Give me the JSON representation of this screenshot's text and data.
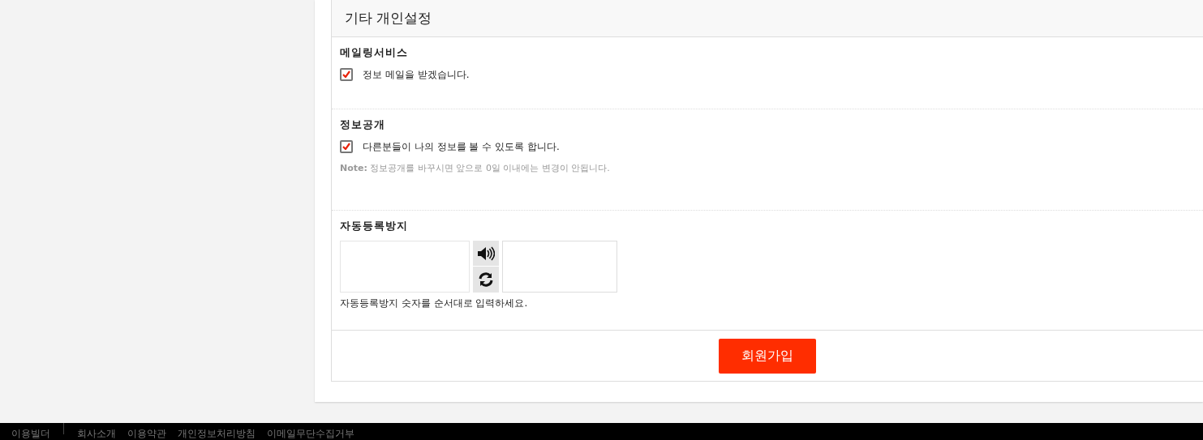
{
  "section_title": "기타 개인설정",
  "groups": [
    {
      "kind": "checkbox",
      "heading": "메일링서비스",
      "label": "정보 메일을 받겠습니다.",
      "checked": true
    },
    {
      "kind": "checkbox",
      "heading": "정보공개",
      "label": "다른분들이 나의 정보를 볼 수 있도록 합니다.",
      "checked": true,
      "note_label": "Note:",
      "note": "정보공개를 바꾸시면 앞으로 0일 이내에는 변경이 안됩니다."
    },
    {
      "kind": "captcha",
      "heading": "자동등록방지",
      "help": "자동등록방지 숫자를 순서대로 입력하세요."
    }
  ],
  "submit": "회원가입",
  "footer": {
    "brand": "이용빌더",
    "links": [
      "회사소개",
      "이용약관",
      "개인정보처리방침",
      "이메일무단수집거부"
    ]
  }
}
